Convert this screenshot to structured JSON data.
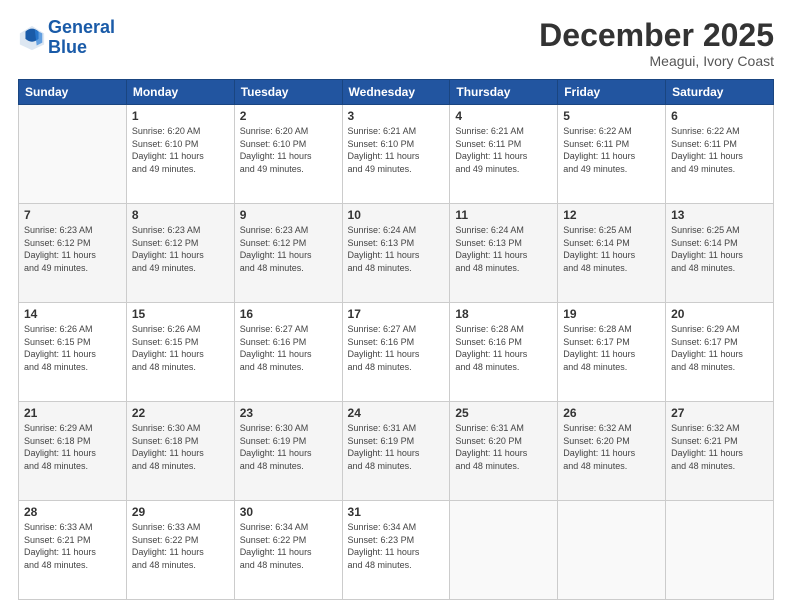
{
  "header": {
    "logo_line1": "General",
    "logo_line2": "Blue",
    "month": "December 2025",
    "location": "Meagui, Ivory Coast"
  },
  "days_of_week": [
    "Sunday",
    "Monday",
    "Tuesday",
    "Wednesday",
    "Thursday",
    "Friday",
    "Saturday"
  ],
  "weeks": [
    [
      {
        "day": "",
        "info": ""
      },
      {
        "day": "1",
        "info": "Sunrise: 6:20 AM\nSunset: 6:10 PM\nDaylight: 11 hours\nand 49 minutes."
      },
      {
        "day": "2",
        "info": "Sunrise: 6:20 AM\nSunset: 6:10 PM\nDaylight: 11 hours\nand 49 minutes."
      },
      {
        "day": "3",
        "info": "Sunrise: 6:21 AM\nSunset: 6:10 PM\nDaylight: 11 hours\nand 49 minutes."
      },
      {
        "day": "4",
        "info": "Sunrise: 6:21 AM\nSunset: 6:11 PM\nDaylight: 11 hours\nand 49 minutes."
      },
      {
        "day": "5",
        "info": "Sunrise: 6:22 AM\nSunset: 6:11 PM\nDaylight: 11 hours\nand 49 minutes."
      },
      {
        "day": "6",
        "info": "Sunrise: 6:22 AM\nSunset: 6:11 PM\nDaylight: 11 hours\nand 49 minutes."
      }
    ],
    [
      {
        "day": "7",
        "info": "Sunrise: 6:23 AM\nSunset: 6:12 PM\nDaylight: 11 hours\nand 49 minutes."
      },
      {
        "day": "8",
        "info": "Sunrise: 6:23 AM\nSunset: 6:12 PM\nDaylight: 11 hours\nand 49 minutes."
      },
      {
        "day": "9",
        "info": "Sunrise: 6:23 AM\nSunset: 6:12 PM\nDaylight: 11 hours\nand 48 minutes."
      },
      {
        "day": "10",
        "info": "Sunrise: 6:24 AM\nSunset: 6:13 PM\nDaylight: 11 hours\nand 48 minutes."
      },
      {
        "day": "11",
        "info": "Sunrise: 6:24 AM\nSunset: 6:13 PM\nDaylight: 11 hours\nand 48 minutes."
      },
      {
        "day": "12",
        "info": "Sunrise: 6:25 AM\nSunset: 6:14 PM\nDaylight: 11 hours\nand 48 minutes."
      },
      {
        "day": "13",
        "info": "Sunrise: 6:25 AM\nSunset: 6:14 PM\nDaylight: 11 hours\nand 48 minutes."
      }
    ],
    [
      {
        "day": "14",
        "info": "Sunrise: 6:26 AM\nSunset: 6:15 PM\nDaylight: 11 hours\nand 48 minutes."
      },
      {
        "day": "15",
        "info": "Sunrise: 6:26 AM\nSunset: 6:15 PM\nDaylight: 11 hours\nand 48 minutes."
      },
      {
        "day": "16",
        "info": "Sunrise: 6:27 AM\nSunset: 6:16 PM\nDaylight: 11 hours\nand 48 minutes."
      },
      {
        "day": "17",
        "info": "Sunrise: 6:27 AM\nSunset: 6:16 PM\nDaylight: 11 hours\nand 48 minutes."
      },
      {
        "day": "18",
        "info": "Sunrise: 6:28 AM\nSunset: 6:16 PM\nDaylight: 11 hours\nand 48 minutes."
      },
      {
        "day": "19",
        "info": "Sunrise: 6:28 AM\nSunset: 6:17 PM\nDaylight: 11 hours\nand 48 minutes."
      },
      {
        "day": "20",
        "info": "Sunrise: 6:29 AM\nSunset: 6:17 PM\nDaylight: 11 hours\nand 48 minutes."
      }
    ],
    [
      {
        "day": "21",
        "info": "Sunrise: 6:29 AM\nSunset: 6:18 PM\nDaylight: 11 hours\nand 48 minutes."
      },
      {
        "day": "22",
        "info": "Sunrise: 6:30 AM\nSunset: 6:18 PM\nDaylight: 11 hours\nand 48 minutes."
      },
      {
        "day": "23",
        "info": "Sunrise: 6:30 AM\nSunset: 6:19 PM\nDaylight: 11 hours\nand 48 minutes."
      },
      {
        "day": "24",
        "info": "Sunrise: 6:31 AM\nSunset: 6:19 PM\nDaylight: 11 hours\nand 48 minutes."
      },
      {
        "day": "25",
        "info": "Sunrise: 6:31 AM\nSunset: 6:20 PM\nDaylight: 11 hours\nand 48 minutes."
      },
      {
        "day": "26",
        "info": "Sunrise: 6:32 AM\nSunset: 6:20 PM\nDaylight: 11 hours\nand 48 minutes."
      },
      {
        "day": "27",
        "info": "Sunrise: 6:32 AM\nSunset: 6:21 PM\nDaylight: 11 hours\nand 48 minutes."
      }
    ],
    [
      {
        "day": "28",
        "info": "Sunrise: 6:33 AM\nSunset: 6:21 PM\nDaylight: 11 hours\nand 48 minutes."
      },
      {
        "day": "29",
        "info": "Sunrise: 6:33 AM\nSunset: 6:22 PM\nDaylight: 11 hours\nand 48 minutes."
      },
      {
        "day": "30",
        "info": "Sunrise: 6:34 AM\nSunset: 6:22 PM\nDaylight: 11 hours\nand 48 minutes."
      },
      {
        "day": "31",
        "info": "Sunrise: 6:34 AM\nSunset: 6:23 PM\nDaylight: 11 hours\nand 48 minutes."
      },
      {
        "day": "",
        "info": ""
      },
      {
        "day": "",
        "info": ""
      },
      {
        "day": "",
        "info": ""
      }
    ]
  ]
}
